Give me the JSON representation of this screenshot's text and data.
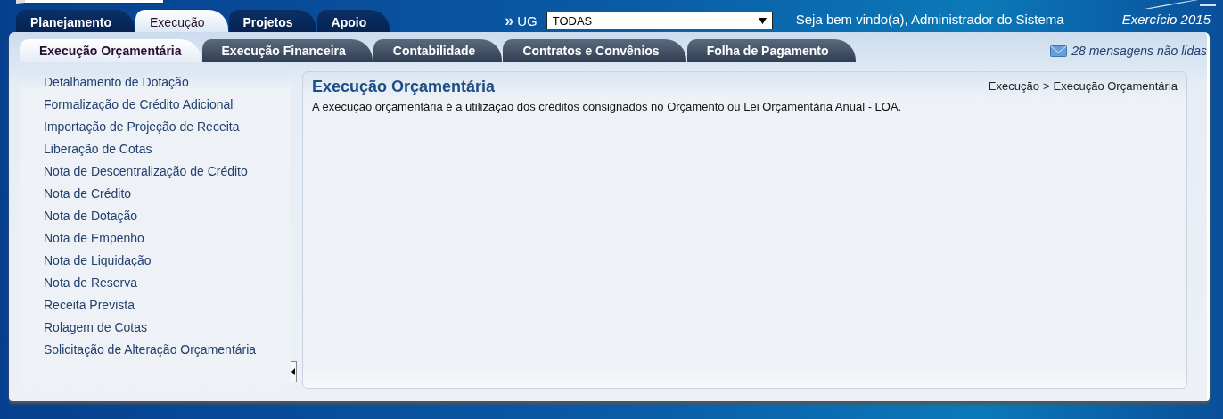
{
  "main_tabs": [
    {
      "label": "Planejamento",
      "selected": false
    },
    {
      "label": "Execução",
      "selected": true
    },
    {
      "label": "Projetos",
      "selected": false
    },
    {
      "label": "Apoio",
      "selected": false
    }
  ],
  "ug": {
    "marker": "»",
    "label": "UG",
    "value": "TODAS"
  },
  "welcome": "Seja bem vindo(a), Administrador do Sistema",
  "year": "Exercício 2015",
  "sub_tabs": [
    {
      "label": "Execução Orçamentária",
      "selected": true
    },
    {
      "label": "Execução Financeira",
      "selected": false
    },
    {
      "label": "Contabilidade",
      "selected": false
    },
    {
      "label": "Contratos e Convênios",
      "selected": false
    },
    {
      "label": "Folha de Pagamento",
      "selected": false
    }
  ],
  "messages": "28 mensagens não lidas",
  "sidebar": {
    "items": [
      "Detalhamento de Dotação",
      "Formalização de Crédito Adicional",
      "Importação de Projeção de Receita",
      "Liberação de Cotas",
      "Nota de Descentralização de Crédito",
      "Nota de Crédito",
      "Nota de Dotação",
      "Nota de Empenho",
      "Nota de Liquidação",
      "Nota de Reserva",
      "Receita Prevista",
      "Rolagem de Cotas",
      "Solicitação de Alteração Orçamentária"
    ]
  },
  "content": {
    "title": "Execução Orçamentária",
    "breadcrumb": {
      "items": [
        "Execução",
        "Execução Orçamentária"
      ],
      "separator": ">"
    },
    "description": "A execução orçamentária é a utilização dos créditos consignados no Orçamento ou Lei Orçamentária Anual - LOA."
  }
}
